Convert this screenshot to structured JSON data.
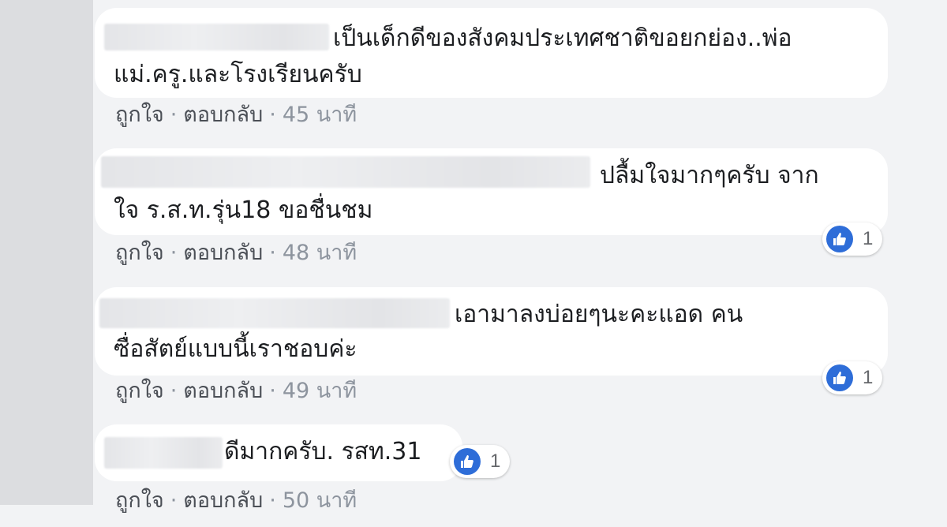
{
  "comments": [
    {
      "text_line1": "เป็นเด็กดีของสังคมประเทศชาติขอยกย่อง..พ่อ",
      "text_line2": "แม่.ครู.และโรงเรียนครับ",
      "like_label": "ถูกใจ",
      "reply_label": "ตอบกลับ",
      "separator": "·",
      "time": "45 นาที"
    },
    {
      "text_line1": "ปลื้มใจมากๆครับ จาก",
      "text_line2": "ใจ ร.ส.ท.รุ่น18 ขอชื่นชม",
      "like_label": "ถูกใจ",
      "reply_label": "ตอบกลับ",
      "separator": "·",
      "time": "48 นาที",
      "reaction_count": "1"
    },
    {
      "text_line1": "เอามาลงบ่อยๆนะคะแอด คน",
      "text_line2": "ซื่อสัตย์แบบนี้เราชอบค่ะ",
      "like_label": "ถูกใจ",
      "reply_label": "ตอบกลับ",
      "separator": "·",
      "time": "49 นาที",
      "reaction_count": "1"
    },
    {
      "text_line1": "ดีมากครับ. รสท.31",
      "like_label": "ถูกใจ",
      "reply_label": "ตอบกลับ",
      "separator": "·",
      "time": "50 นาที",
      "reaction_count": "1"
    }
  ],
  "colors": {
    "background": "#f2f3f5",
    "bubble": "#ffffff",
    "meta_text": "#8d949e",
    "like_badge": "#2e6dd8"
  },
  "icons": {
    "reaction": "thumbs-up-icon"
  }
}
